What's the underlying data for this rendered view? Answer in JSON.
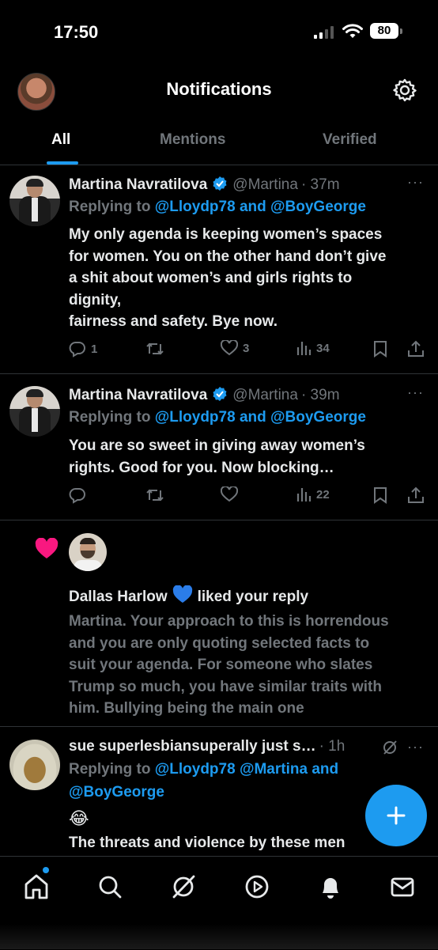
{
  "status_bar": {
    "time": "17:50",
    "battery": "80"
  },
  "header": {
    "title": "Notifications"
  },
  "tabs": [
    {
      "label": "All"
    },
    {
      "label": "Mentions"
    },
    {
      "label": "Verified"
    }
  ],
  "tweets": [
    {
      "name": "Martina Navratilova",
      "handle": "@Martina",
      "time": "· 37m",
      "replying_prefix": "Replying to ",
      "replying_to": "@Lloydp78 and @BoyGeorge",
      "lines": [
        "My only agenda is keeping women’s spaces",
        "for women. You on the other hand don’t give",
        "a shit about women’s and girls rights to",
        "dignity,",
        "fairness and safety. Bye now."
      ],
      "replies": "1",
      "retweets": "",
      "likes": "3",
      "views": "34"
    },
    {
      "name": "Martina Navratilova",
      "handle": "@Martina",
      "time": "· 39m",
      "replying_prefix": "Replying to ",
      "replying_to": "@Lloydp78 and @BoyGeorge",
      "lines": [
        "You are so sweet in giving away women’s",
        "rights. Good for you. Now blocking…"
      ],
      "replies": "",
      "retweets": "",
      "likes": "",
      "views": "22"
    }
  ],
  "like_notification": {
    "user": "Dallas Harlow",
    "action": "liked your reply",
    "lines": [
      "Martina. Your approach to this is horrendous",
      "and you are only quoting selected facts to",
      "suit your agenda. For someone who slates",
      "Trump so much, you have similar traits with",
      "him. Bullying being the main one"
    ]
  },
  "tweet3": {
    "name": "sue superlesbiansuperally just s…",
    "time": "· 1h",
    "replying_prefix": "Replying to ",
    "replying_to_line1": "@Lloydp78 @Martina and",
    "replying_to_line2": "@BoyGeorge",
    "emoji": "😂",
    "line1": "The threats and violence by these men"
  },
  "more_label": "···",
  "colors": {
    "accent": "#1d9bf0",
    "muted": "#71767b",
    "heart": "#f91880"
  },
  "icons": [
    "gear-icon",
    "verified-badge-icon",
    "reply-icon",
    "retweet-icon",
    "like-icon",
    "views-icon",
    "bookmark-icon",
    "share-icon",
    "home-icon",
    "search-icon",
    "grok-icon",
    "video-icon",
    "bell-icon",
    "mail-icon",
    "plus-icon"
  ]
}
